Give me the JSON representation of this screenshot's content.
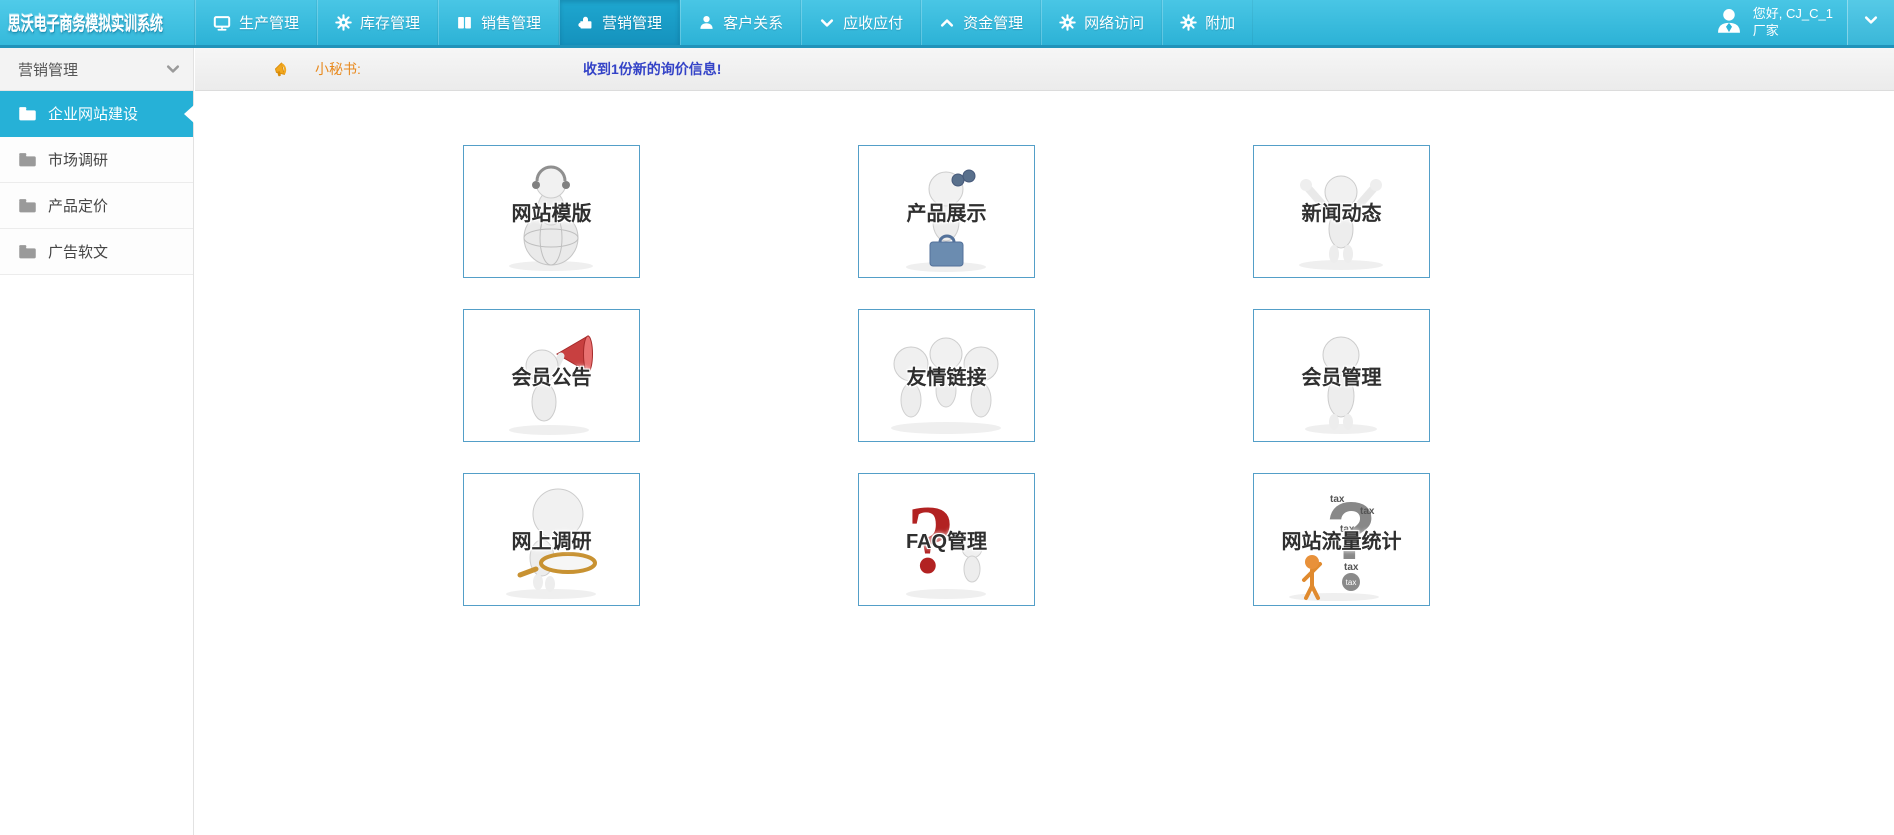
{
  "app": {
    "title": "思沃电子商务模拟实训系统"
  },
  "nav": {
    "tabs": [
      {
        "key": "production",
        "label": "生产管理",
        "icon": "monitor-icon",
        "active": false
      },
      {
        "key": "inventory",
        "label": "库存管理",
        "icon": "gear-icon",
        "active": false
      },
      {
        "key": "sales",
        "label": "销售管理",
        "icon": "books-icon",
        "active": false
      },
      {
        "key": "marketing",
        "label": "营销管理",
        "icon": "puzzle-icon",
        "active": true
      },
      {
        "key": "customer",
        "label": "客户关系",
        "icon": "person-icon",
        "active": false
      },
      {
        "key": "receivables",
        "label": "应收应付",
        "icon": "chevron-down-icon",
        "active": false
      },
      {
        "key": "funds",
        "label": "资金管理",
        "icon": "chevron-up-icon",
        "active": false
      },
      {
        "key": "network",
        "label": "网络访问",
        "icon": "gear-icon",
        "active": false
      },
      {
        "key": "extra",
        "label": "附加",
        "icon": "gear-icon",
        "active": false
      }
    ],
    "user": {
      "greeting": "您好, CJ_C_1",
      "role": "厂家"
    }
  },
  "sidebar": {
    "header": "营销管理",
    "items": [
      {
        "key": "website-build",
        "label": "企业网站建设",
        "active": true
      },
      {
        "key": "market-research",
        "label": "市场调研",
        "active": false
      },
      {
        "key": "product-pricing",
        "label": "产品定价",
        "active": false
      },
      {
        "key": "ad-copy",
        "label": "广告软文",
        "active": false
      }
    ]
  },
  "secretary": {
    "label": "小秘书:",
    "message": "收到1份新的询价信息!"
  },
  "cards": [
    {
      "key": "website-template",
      "label": "网站模版",
      "icon": "globe-figure"
    },
    {
      "key": "product-display",
      "label": "产品展示",
      "icon": "binocular-figure"
    },
    {
      "key": "news",
      "label": "新闻动态",
      "icon": "cheer-figure"
    },
    {
      "key": "member-notice",
      "label": "会员公告",
      "icon": "megaphone-figure"
    },
    {
      "key": "friend-links",
      "label": "友情链接",
      "icon": "three-figures"
    },
    {
      "key": "member-manage",
      "label": "会员管理",
      "icon": "single-figure"
    },
    {
      "key": "online-survey",
      "label": "网上调研",
      "icon": "magnifier-figure"
    },
    {
      "key": "faq",
      "label": "FAQ管理",
      "icon": "red-question-figure"
    },
    {
      "key": "site-traffic",
      "label": "网站流量统计",
      "icon": "word-question-figure"
    }
  ],
  "colors": {
    "nav_top": "#49c6e5",
    "nav_bottom": "#2cb2d6",
    "nav_border": "#2093ba",
    "active_tab": "#189dc7",
    "sidebar_active": "#26b1d7",
    "card_border": "#549fc8",
    "message_text": "#3443c7",
    "secretary_label": "#e8891d"
  }
}
